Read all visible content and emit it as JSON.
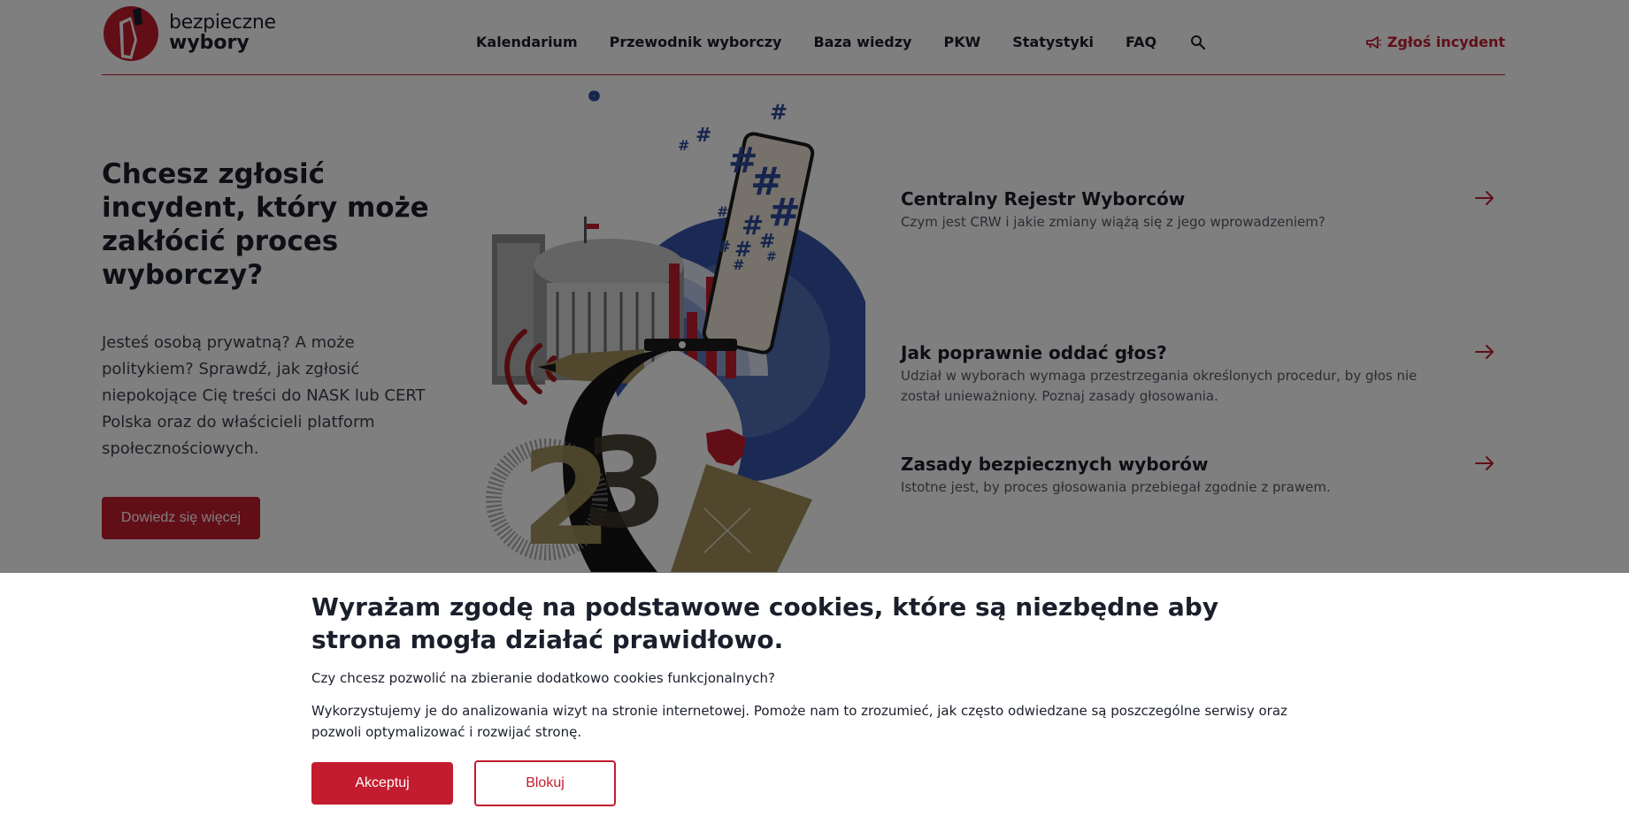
{
  "brand": {
    "line1": "bezpieczne",
    "line2": "wybory",
    "accent_color": "#c31c2e",
    "logo_icon": "ballot-box-logo-icon"
  },
  "nav": {
    "items": [
      "Kalendarium",
      "Przewodnik wyborczy",
      "Baza wiedzy",
      "PKW",
      "Statystyki",
      "FAQ"
    ],
    "search_icon": "search-icon",
    "report_label": "Zgłoś incydent",
    "report_icon": "megaphone-icon"
  },
  "hero": {
    "title": "Chcesz zgłosić incydent, który może zakłócić proces wyborczy?",
    "description": "Jesteś osobą prywatną? A może politykiem? Sprawdź, jak zgłosić niepokojące Cię treści do NASK lub CERT Polska oraz do właścicieli platform społecznościowych.",
    "button_label": "Dowiedz się więcej",
    "illustration_icon": "elections-collage-illustration"
  },
  "info_list": [
    {
      "title": "Centralny Rejestr Wyborców",
      "description": "Czym jest CRW i jakie zmiany wiążą się z jego wprowadzeniem?"
    },
    {
      "title": "Jak poprawnie oddać głos?",
      "description": "Udział w wyborach wymaga przestrzegania określonych procedur, by głos nie został unieważniony. Poznaj zasady głosowania."
    },
    {
      "title": "Zasady bezpiecznych wyborów",
      "description": "Istotne jest, by proces głosowania przebiegał zgodnie z prawem."
    }
  ],
  "cookie": {
    "title": "Wyrażam zgodę na podstawowe cookies, które są niezbędne aby strona mogła działać prawidłowo.",
    "question": "Czy chcesz pozwolić na zbieranie dodatkowo cookies funkcjonalnych?",
    "text": "Wykorzystujemy je do analizowania wizyt na stronie internetowej. Pomoże nam to zrozumieć, jak często odwiedzane są poszczególne serwisy oraz pozwoli optymalizować i rozwijać stronę.",
    "accept_label": "Akceptuj",
    "block_label": "Blokuj"
  }
}
